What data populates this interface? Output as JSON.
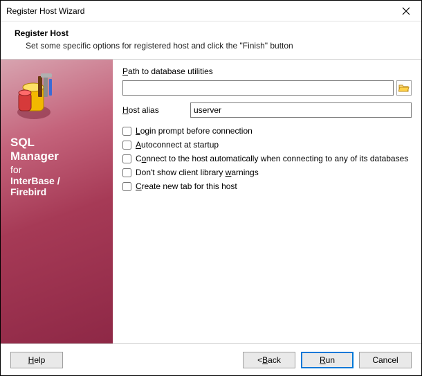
{
  "window": {
    "title": "Register Host Wizard"
  },
  "header": {
    "title": "Register Host",
    "subtitle": "Set some specific options for registered host and click the \"Finish\" button"
  },
  "sidebar": {
    "brand1": "SQL",
    "brand2": "Manager",
    "brand3": "for",
    "brand4": "InterBase /",
    "brand5": "Firebird"
  },
  "form": {
    "path_label_pre": "P",
    "path_label_post": "ath to database utilities",
    "path_value": "",
    "alias_label_pre": "H",
    "alias_label_post": "ost alias",
    "alias_value": "userver",
    "checks": [
      {
        "pre": "",
        "u": "L",
        "post": "ogin prompt before connection",
        "checked": false
      },
      {
        "pre": "",
        "u": "A",
        "post": "utoconnect at startup",
        "checked": false
      },
      {
        "pre": "C",
        "u": "o",
        "post": "nnect to the host automatically when connecting to any of its databases",
        "checked": false
      },
      {
        "pre": "Don't show client library ",
        "u": "w",
        "post": "arnings",
        "checked": false
      },
      {
        "pre": "",
        "u": "C",
        "post": "reate new tab for this host",
        "checked": false
      }
    ]
  },
  "footer": {
    "help": "Help",
    "back": "< Back",
    "run": "Run",
    "cancel": "Cancel"
  }
}
